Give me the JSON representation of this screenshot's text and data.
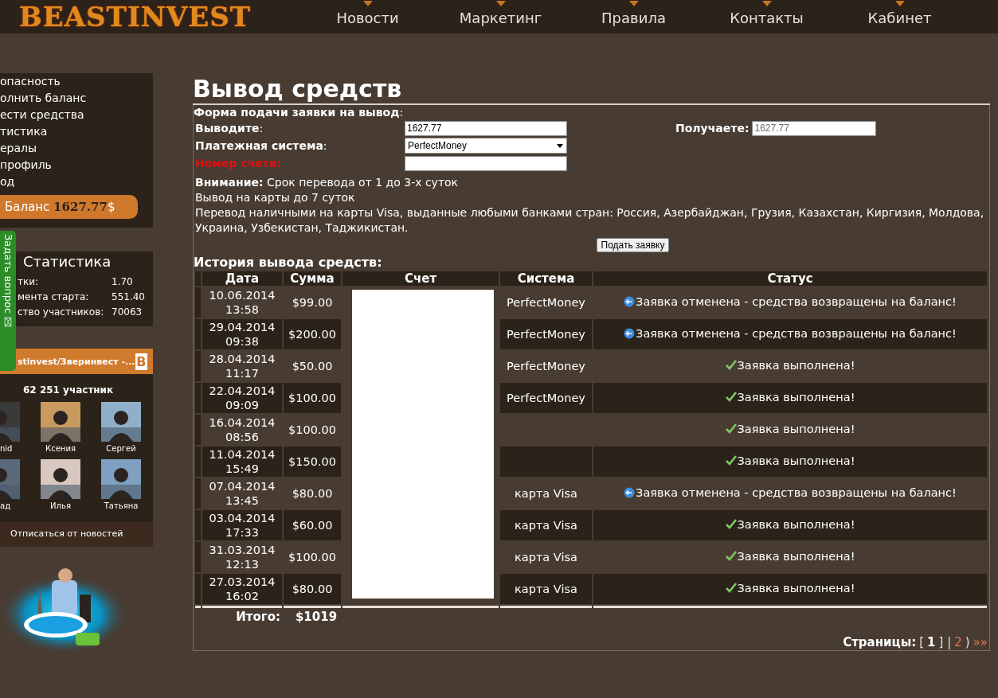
{
  "header": {
    "logo": "BEASTINVEST",
    "nav": [
      {
        "label": "Новости"
      },
      {
        "label": "Маркетинг"
      },
      {
        "label": "Правила"
      },
      {
        "label": "Контакты"
      },
      {
        "label": "Кабинет"
      }
    ]
  },
  "sidebar": {
    "menu": [
      "опасность",
      "олнить баланс",
      "ести средства",
      "тистика",
      "ералы",
      "профиль",
      "од"
    ],
    "balance": {
      "label": "Баланс",
      "amount": "1627.77",
      "currency": "$"
    },
    "stats": {
      "title": "Статистика",
      "rows": [
        {
          "label": "тки:",
          "value": "1.70"
        },
        {
          "label": "мента старта:",
          "value": "551.40"
        },
        {
          "label": "ство участников:",
          "value": "70063"
        }
      ]
    },
    "community": {
      "title": "stinvest/Зверинвест -...",
      "logo": "B",
      "members": "62 251 участник",
      "people": [
        "nid",
        "Ксения",
        "Сергей",
        "ад",
        "Илья",
        "Татьяна"
      ],
      "unsubscribe": "Отписаться от новостей"
    },
    "ask_tab": "Задать вопрос"
  },
  "page": {
    "title": "Вывод средств",
    "form": {
      "legend": "Форма подачи заявки на вывод",
      "colon": ":",
      "amount": {
        "label": "Выводите",
        "value": "1627.77"
      },
      "receive": {
        "label": "Получаете:",
        "value": "1627.77",
        "disabled": true
      },
      "system": {
        "label": "Платежная система",
        "value": "PerfectMoney"
      },
      "account": {
        "label": "Номер счета:",
        "required": true
      },
      "notice": [
        "**Внимание:** Срок перевода от 1 до 3-х суток",
        "Вывод на карты до 7 суток",
        "Перевод наличными на карты Visa, выданные любыми банками стран: Россия, Азербайджан, Грузия, Казахстан, Киргизия, Молдова, Украина, Узбекистан, Таджикистан."
      ],
      "submit": "Подать заявку"
    },
    "history": {
      "title": "История вывода средств:",
      "columns": [
        "Дата",
        "Сумма",
        "Счет",
        "Система",
        "Статус"
      ],
      "rows": [
        {
          "date": "10.06.2014",
          "time": "13:58",
          "sum": "$99.00",
          "system": "PerfectMoney",
          "status": "Заявка отменена - средства возвращены на баланс!",
          "kind": "cancelled"
        },
        {
          "date": "29.04.2014",
          "time": "09:38",
          "sum": "$200.00",
          "system": "PerfectMoney",
          "status": "Заявка отменена - средства возвращены на баланс!",
          "kind": "cancelled"
        },
        {
          "date": "28.04.2014",
          "time": "11:17",
          "sum": "$50.00",
          "system": "PerfectMoney",
          "status": "Заявка выполнена!",
          "kind": "done"
        },
        {
          "date": "22.04.2014",
          "time": "09:09",
          "sum": "$100.00",
          "system": "PerfectMoney",
          "status": "Заявка выполнена!",
          "kind": "done"
        },
        {
          "date": "16.04.2014",
          "time": "08:56",
          "sum": "$100.00",
          "status": "Заявка выполнена!",
          "kind": "done"
        },
        {
          "date": "11.04.2014",
          "time": "15:49",
          "sum": "$150.00",
          "status": "Заявка выполнена!",
          "kind": "done"
        },
        {
          "date": "07.04.2014",
          "time": "13:45",
          "sum": "$80.00",
          "system": "карта Visa",
          "status": "Заявка отменена - средства возвращены на баланс!",
          "kind": "cancelled"
        },
        {
          "date": "03.04.2014",
          "time": "17:33",
          "sum": "$60.00",
          "system": "карта Visa",
          "status": "Заявка выполнена!",
          "kind": "done"
        },
        {
          "date": "31.03.2014",
          "time": "12:13",
          "sum": "$100.00",
          "system": "карта Visa",
          "status": "Заявка выполнена!",
          "kind": "done"
        },
        {
          "date": "27.03.2014",
          "time": "16:02",
          "sum": "$80.00",
          "system": "карта Visa",
          "status": "Заявка выполнена!",
          "kind": "done"
        }
      ],
      "total_label": "Итого:",
      "total": "$1019"
    },
    "pager": {
      "label": "Страницы:",
      "parts": [
        {
          "kind": "text",
          "text": "["
        },
        {
          "kind": "page",
          "text": "1",
          "selected": true
        },
        {
          "kind": "text",
          "text": "] |"
        },
        {
          "kind": "page",
          "text": "2",
          "selected": false
        },
        {
          "kind": "text",
          "text": ")"
        },
        {
          "kind": "link",
          "text": "»»"
        }
      ]
    }
  }
}
